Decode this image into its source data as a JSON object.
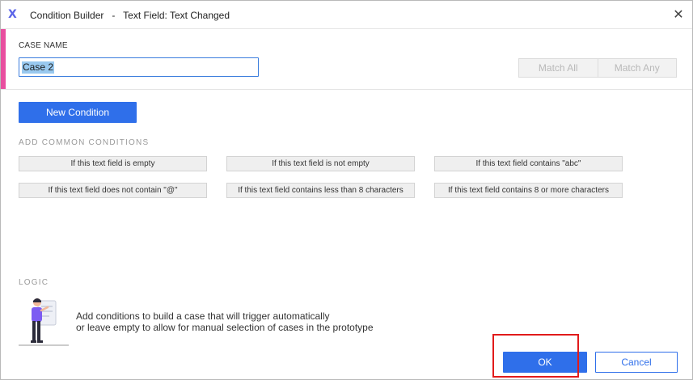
{
  "window": {
    "title": "Condition Builder   -   Text Field: Text Changed",
    "close_glyph": "✕",
    "logo": "X"
  },
  "case": {
    "label": "CASE NAME",
    "value": "Case 2",
    "match_all": "Match All",
    "match_any": "Match Any"
  },
  "actions": {
    "new_condition": "New Condition"
  },
  "common": {
    "label": "ADD COMMON CONDITIONS",
    "conditions": [
      "If this text field is empty",
      "If this text field is not empty",
      "If this text field contains \"abc\"",
      "If this text field does not contain \"@\"",
      "If this text field contains less than 8 characters",
      "If this text field contains 8 or more characters"
    ]
  },
  "logic": {
    "label": "LOGIC",
    "line1": "Add conditions to build a case that will trigger automatically",
    "line2": "or leave empty to allow for manual selection of cases in the prototype"
  },
  "footer": {
    "ok": "OK",
    "cancel": "Cancel"
  },
  "colors": {
    "accent": "#e84f9f",
    "primary": "#2f6fea",
    "highlight": "#e11b1b"
  }
}
